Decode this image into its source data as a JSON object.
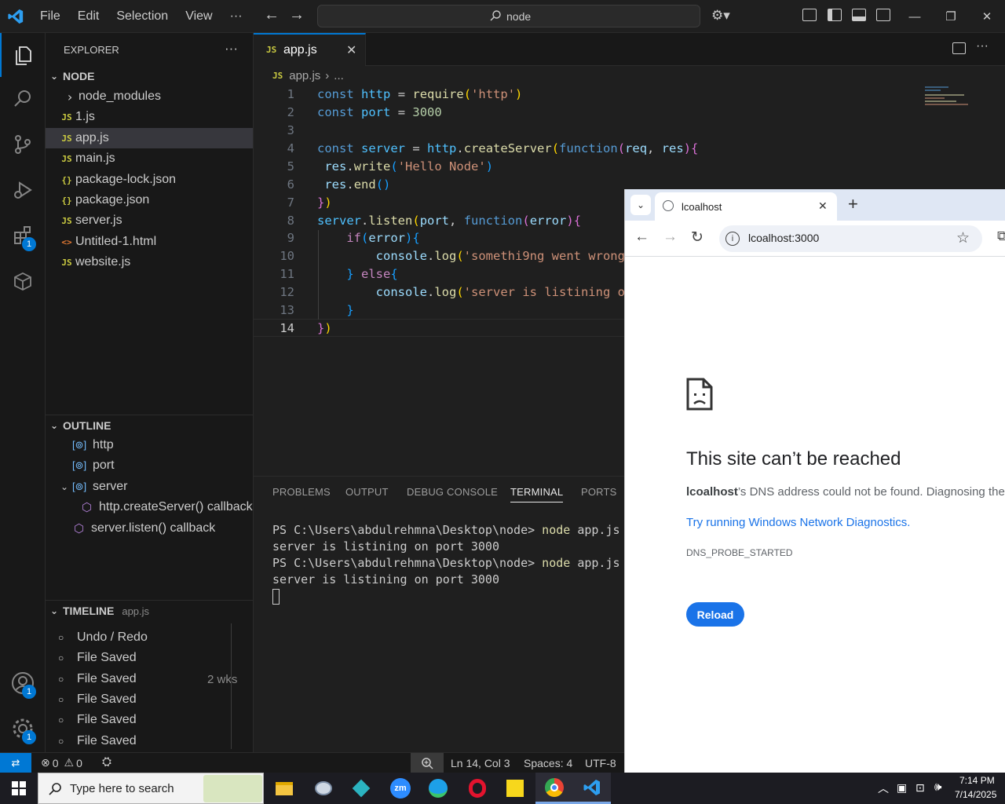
{
  "titlebar": {
    "menu": [
      "File",
      "Edit",
      "Selection",
      "View",
      "···"
    ],
    "search_text": "node"
  },
  "activity": {
    "extensions_badge": "1",
    "accounts_badge": "1",
    "settings_badge": "1"
  },
  "sidebar": {
    "title": "EXPLORER",
    "more": "···",
    "folder": "NODE",
    "files": [
      {
        "icon": "›",
        "name": "node_modules"
      },
      {
        "icon": "JS",
        "name": "1.js"
      },
      {
        "icon": "JS",
        "name": "app.js"
      },
      {
        "icon": "JS",
        "name": "main.js"
      },
      {
        "icon": "{}",
        "name": "package-lock.json"
      },
      {
        "icon": "{}",
        "name": "package.json"
      },
      {
        "icon": "JS",
        "name": "server.js"
      },
      {
        "icon": "<>",
        "name": "Untitled-1.html"
      },
      {
        "icon": "JS",
        "name": "website.js"
      }
    ],
    "outline_title": "OUTLINE",
    "outline": [
      "http",
      "port",
      "server",
      "http.createServer() callback",
      "server.listen() callback"
    ],
    "timeline_title": "TIMELINE",
    "timeline_file": "app.js",
    "timeline": [
      {
        "label": "Undo / Redo",
        "time": ""
      },
      {
        "label": "File Saved",
        "time": ""
      },
      {
        "label": "File Saved",
        "time": "2 wks"
      },
      {
        "label": "File Saved",
        "time": ""
      },
      {
        "label": "File Saved",
        "time": ""
      },
      {
        "label": "File Saved",
        "time": ""
      }
    ]
  },
  "editor": {
    "tab_icon": "JS",
    "tab_label": "app.js",
    "breadcrumb_icon": "JS",
    "breadcrumb_file": "app.js",
    "breadcrumb_rest": "...",
    "line_numbers": [
      "1",
      "2",
      "3",
      "4",
      "5",
      "6",
      "7",
      "8",
      "9",
      "10",
      "11",
      "12",
      "13",
      "14"
    ]
  },
  "panel": {
    "tabs": [
      "PROBLEMS",
      "OUTPUT",
      "DEBUG CONSOLE",
      "TERMINAL",
      "PORTS"
    ],
    "active_tab": "TERMINAL",
    "terminal": [
      {
        "prompt": "PS C:\\Users\\abdulrehmna\\Desktop\\node> ",
        "cmd": "node",
        "args": " app.js"
      },
      {
        "out": "server is listining on port 3000"
      },
      {
        "prompt": "PS C:\\Users\\abdulrehmna\\Desktop\\node> ",
        "cmd": "node",
        "args": " app.js"
      },
      {
        "out": "server is listining on port 3000"
      }
    ]
  },
  "statusbar": {
    "errors": "0",
    "warnings": "0",
    "position": "Ln 14, Col 3",
    "spaces": "Spaces: 4",
    "encoding": "UTF-8"
  },
  "browser": {
    "tab_title": "lcoalhost",
    "url": "lcoalhost:3000",
    "error_title": "This site can’t be reached",
    "error_host": "lcoalhost",
    "error_desc": "’s DNS address could not be found. Diagnosing the",
    "diagnostics_link": "Try running Windows Network Diagnostics.",
    "error_code": "DNS_PROBE_STARTED",
    "reload": "Reload",
    "link_color": "#1a73e8"
  },
  "taskbar": {
    "search_placeholder": "Type here to search",
    "time": "7:14 PM",
    "date": "7/14/2025",
    "zoom_label": "zm"
  }
}
